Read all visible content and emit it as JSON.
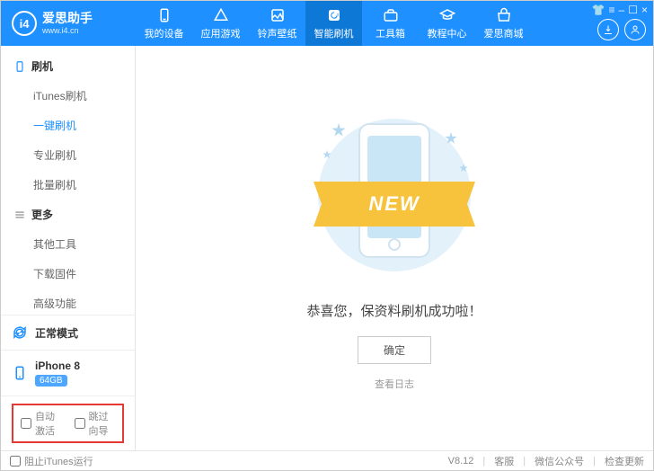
{
  "app": {
    "title": "爱思助手",
    "url": "www.i4.cn",
    "logo_letter": "i4"
  },
  "top_tabs": [
    {
      "label": "我的设备"
    },
    {
      "label": "应用游戏"
    },
    {
      "label": "铃声壁纸"
    },
    {
      "label": "智能刷机"
    },
    {
      "label": "工具箱"
    },
    {
      "label": "教程中心"
    },
    {
      "label": "爱思商城"
    }
  ],
  "sidebar": {
    "group1_title": "刷机",
    "group1_items": [
      "iTunes刷机",
      "一键刷机",
      "专业刷机",
      "批量刷机"
    ],
    "group2_title": "更多",
    "group2_items": [
      "其他工具",
      "下载固件",
      "高级功能"
    ]
  },
  "mode": {
    "label": "正常模式"
  },
  "device": {
    "name": "iPhone 8",
    "storage": "64GB"
  },
  "options": {
    "auto_activate": "自动激活",
    "skip_setup": "跳过向导"
  },
  "main": {
    "ribbon_text": "NEW",
    "success_text": "恭喜您，保资料刷机成功啦！",
    "ok_button": "确定",
    "view_log": "查看日志"
  },
  "footer": {
    "block_itunes": "阻止iTunes运行",
    "version": "V8.12",
    "support": "客服",
    "wechat": "微信公众号",
    "update": "检查更新"
  }
}
